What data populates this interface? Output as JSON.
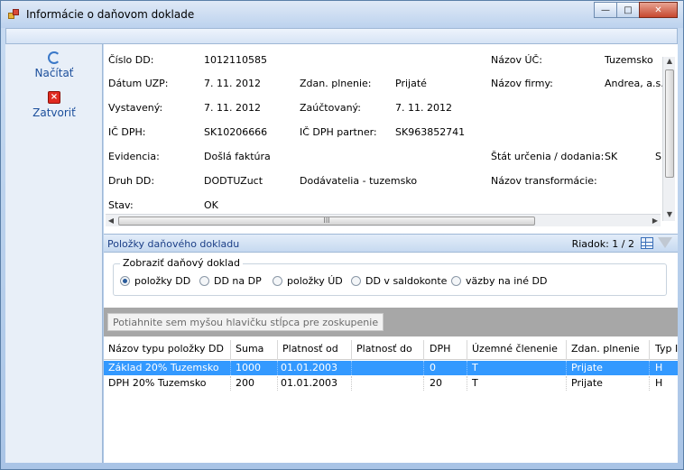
{
  "window": {
    "title": "Informácie o daňovom doklade",
    "controls": {
      "minimize": "—",
      "maximize": "□",
      "close": "✕"
    }
  },
  "sidebar": {
    "load_label": "Načítať",
    "close_label": "Zatvoriť"
  },
  "info": {
    "cislo_dd_label": "Číslo DD:",
    "cislo_dd_value": "1012110585",
    "datum_uzp_label": "Dátum UZP:",
    "datum_uzp_value": "7. 11. 2012",
    "vystaveny_label": "Vystavený:",
    "vystaveny_value": "7. 11. 2012",
    "ic_dph_label": "IČ DPH:",
    "ic_dph_value": "SK10206666",
    "evidencia_label": "Evidencia:",
    "evidencia_value": "Došlá faktúra",
    "druh_dd_label": "Druh DD:",
    "druh_dd_value": "DODTUZuct",
    "stav_label": "Stav:",
    "stav_value": "OK",
    "zdan_plnenie_label": "Zdan. plnenie:",
    "zdan_plnenie_value": "Prijaté",
    "zauctovany_label": "Zaúčtovaný:",
    "zauctovany_value": "7. 11. 2012",
    "ic_dph_partner_label": "IČ DPH partner:",
    "ic_dph_partner_value": "SK963852741",
    "druh_dd_desc": "Dodávatelia - tuzemsko",
    "nazov_uc_label": "Názov ÚČ:",
    "nazov_uc_value": "Tuzemsko",
    "nazov_firmy_label": "Názov firmy:",
    "nazov_firmy_value": "Andrea, a.s.",
    "stat_label": "Štát určenia / dodania:",
    "stat_value": "SK",
    "stat_value2": "Sl",
    "nazov_transformacie_label": "Názov transformácie:"
  },
  "scrollbar": {
    "grip": "III",
    "up": "▲",
    "down": "▼",
    "left": "◀",
    "right": "▶"
  },
  "items_section": {
    "title": "Položky daňového dokladu",
    "row_count": "Riadok: 1 / 2"
  },
  "view_group": {
    "legend": "Zobraziť daňový doklad",
    "options": [
      "položky DD",
      "DD na DP",
      "položky ÚD",
      "DD v saldokonte",
      "väzby na iné DD"
    ],
    "selected": "položky DD"
  },
  "group_hint": "Potiahnite sem myšou hlavičku stĺpca pre zoskupenie",
  "table": {
    "columns": [
      "Názov typu položky DD",
      "Suma",
      "Platnosť od",
      "Platnosť do",
      "DPH",
      "Územné členenie",
      "Zdan. plnenie",
      "Typ I"
    ],
    "rows": [
      [
        "Základ 20% Tuzemsko",
        "1000",
        "01.01.2003",
        "",
        "0",
        "T",
        "Prijate",
        "H"
      ],
      [
        "DPH 20% Tuzemsko",
        "200",
        "01.01.2003",
        "",
        "20",
        "T",
        "Prijate",
        "H"
      ]
    ],
    "selected_row": 0
  },
  "colors": {
    "selection": "#3399ff",
    "section_title": "#1c3f87",
    "sidebar_text": "#1c4f9c"
  }
}
